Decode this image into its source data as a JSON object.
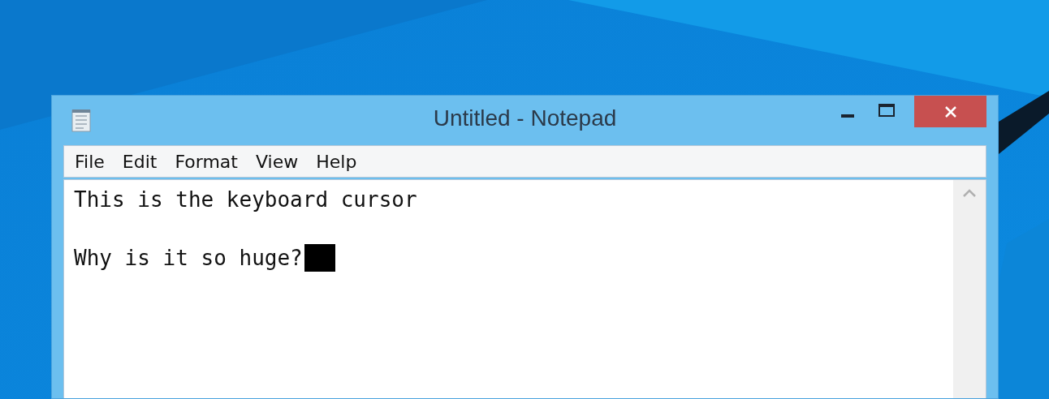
{
  "window": {
    "title": "Untitled - Notepad"
  },
  "menu": [
    {
      "label": "File"
    },
    {
      "label": "Edit"
    },
    {
      "label": "Format"
    },
    {
      "label": "View"
    },
    {
      "label": "Help"
    }
  ],
  "document": {
    "lines": [
      {
        "text": "This is the keyboard cursor",
        "blank_before": false
      },
      {
        "text": "Why is it so huge?",
        "blank_before": true
      }
    ],
    "caret": {
      "kind": "block"
    }
  }
}
